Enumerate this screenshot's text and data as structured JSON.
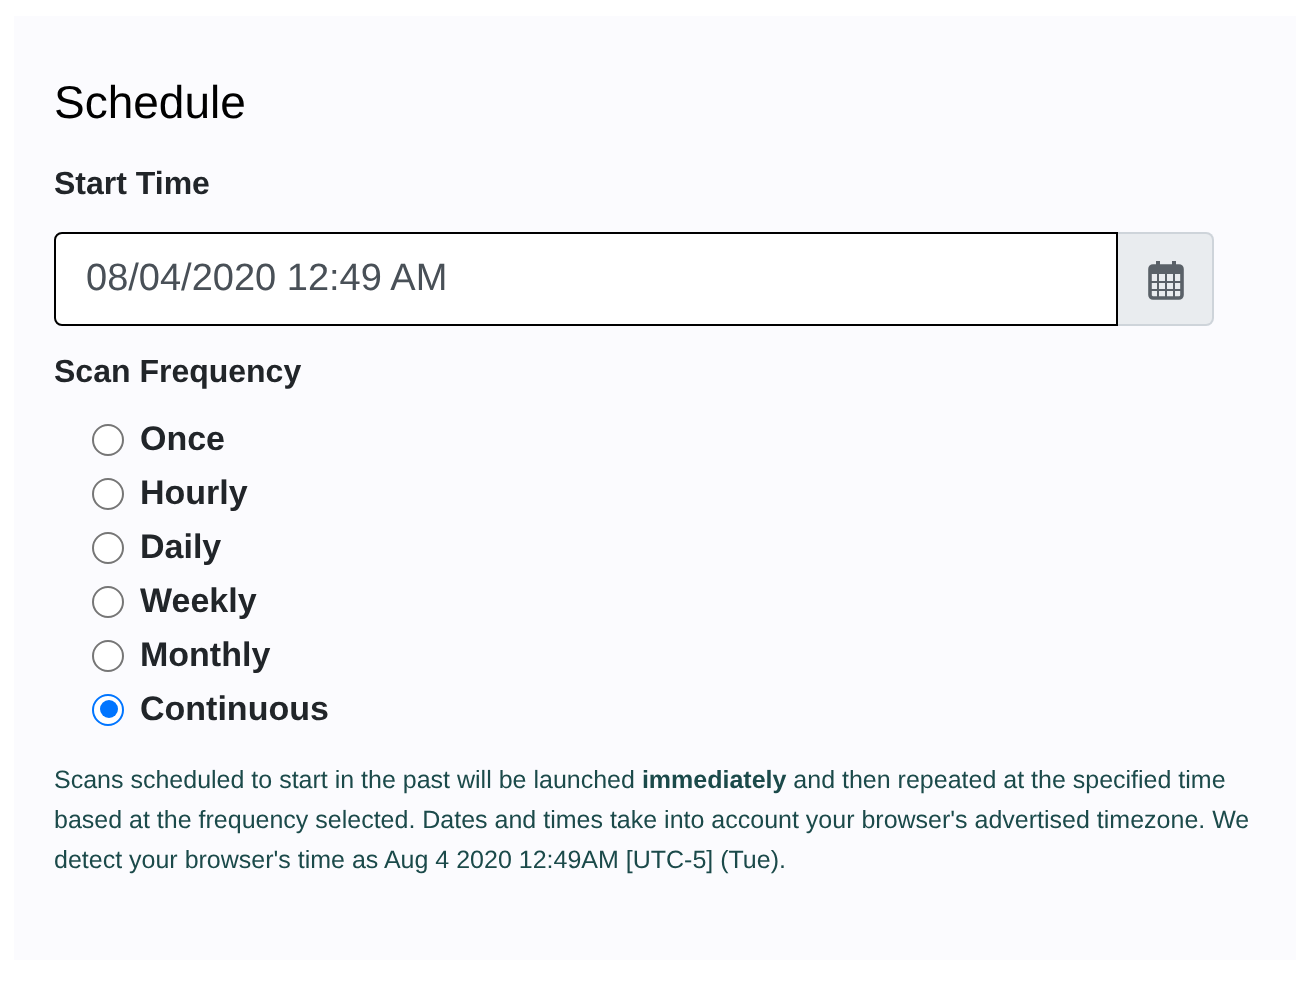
{
  "title": "Schedule",
  "start_time": {
    "label": "Start Time",
    "value": "08/04/2020 12:49 AM"
  },
  "scan_frequency": {
    "label": "Scan Frequency",
    "options": [
      {
        "label": "Once",
        "selected": false
      },
      {
        "label": "Hourly",
        "selected": false
      },
      {
        "label": "Daily",
        "selected": false
      },
      {
        "label": "Weekly",
        "selected": false
      },
      {
        "label": "Monthly",
        "selected": false
      },
      {
        "label": "Continuous",
        "selected": true
      }
    ]
  },
  "help_text": "Scans scheduled to start in the past will be launched **immediately** and then repeated at the specified time based at the frequency selected. Dates and times take into account your browser's advertised timezone. We detect your browser's time as Aug 4 2020 12:49AM [UTC-5] (Tue)."
}
